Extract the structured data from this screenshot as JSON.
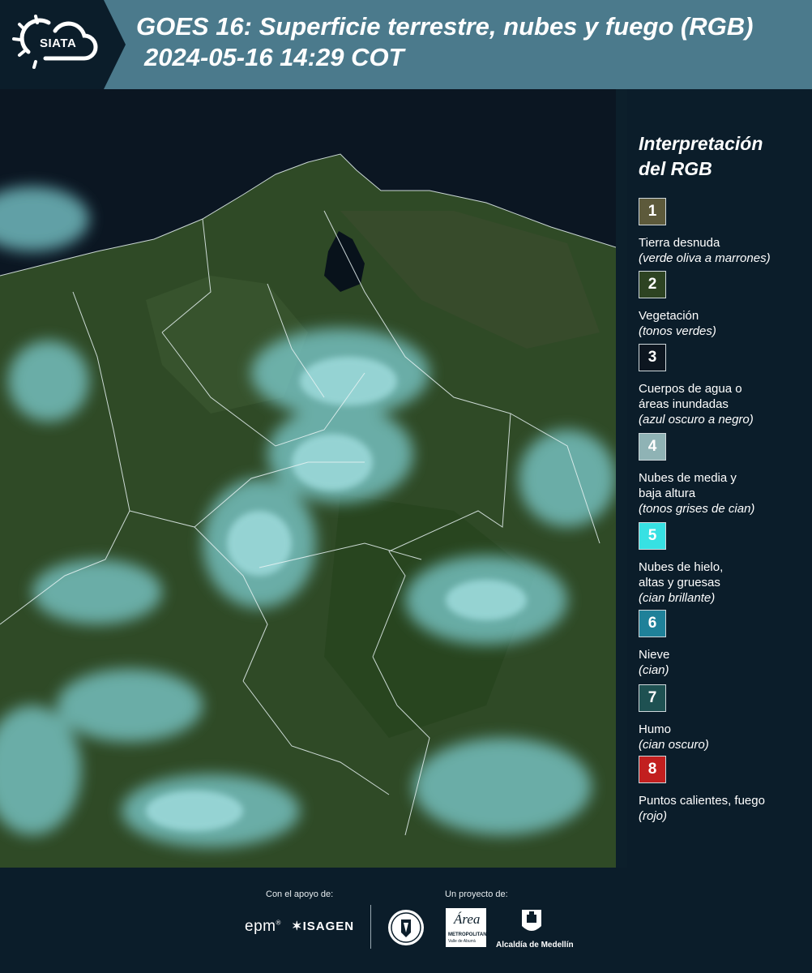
{
  "header": {
    "logo_text": "SIATA",
    "title_line1": "GOES 16: Superficie terrestre, nubes y fuego (RGB)",
    "title_line2": "2024-05-16 14:29 COT"
  },
  "legend": {
    "title_line1": "Interpretación",
    "title_line2": "del RGB",
    "items": [
      {
        "num": "1",
        "name": "Tierra desnuda",
        "desc": "(verde oliva a marrones)",
        "color": "#5d5a3b"
      },
      {
        "num": "2",
        "name": "Vegetación",
        "desc": "(tonos verdes)",
        "color": "#2d4322"
      },
      {
        "num": "3",
        "name": "Cuerpos de agua o áreas inundadas",
        "desc": "(azul oscuro a negro)",
        "color": "#0d1620"
      },
      {
        "num": "4",
        "name": "Nubes de media y baja altura",
        "desc": "(tonos grises de cian)",
        "color": "#8fb3b5"
      },
      {
        "num": "5",
        "name": "Nubes de hielo, altas y gruesas",
        "desc": "(cian brillante)",
        "color": "#37e1e3"
      },
      {
        "num": "6",
        "name": "Nieve",
        "desc": "(cian)",
        "color": "#1f8199"
      },
      {
        "num": "7",
        "name": "Humo",
        "desc": "(cian oscuro)",
        "color": "#1e5152"
      },
      {
        "num": "8",
        "name": "Puntos calientes, fuego",
        "desc": "(rojo)",
        "color": "#c21f1f"
      }
    ]
  },
  "footer": {
    "support_label": "Con el apoyo de:",
    "project_label": "Un proyecto de:",
    "epm": "epm",
    "isagen": "ISAGEN",
    "area_name": "Área",
    "area_sub": "METROPOLITANA",
    "area_sub2": "Valle de Aburrá",
    "alcaldia": "Alcaldía de Medellín"
  }
}
